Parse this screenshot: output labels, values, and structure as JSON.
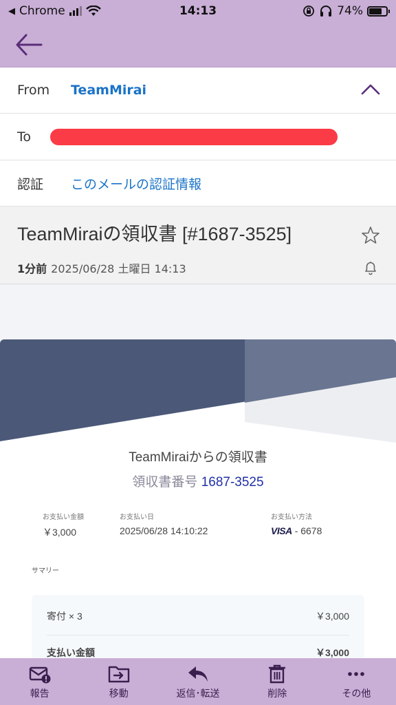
{
  "status": {
    "back_app": "Chrome",
    "time": "14:13",
    "battery": "74%",
    "battery_level": 0.74
  },
  "email": {
    "from_label": "From",
    "from_value": "TeamMirai",
    "to_label": "To",
    "auth_label": "認証",
    "auth_link": "このメールの認証情報",
    "subject": "TeamMiraiの領収書 [#1687-3525]",
    "relative_time": "1分前",
    "date": "2025/06/28 土曜日 14:13"
  },
  "receipt": {
    "title": "TeamMiraiからの領収書",
    "number_label": "領収書番号",
    "number": "1687-3525",
    "amount_label": "お支払い金額",
    "amount": "￥3,000",
    "date_label": "お支払い日",
    "date": "2025/06/28 14:10:22",
    "method_label": "お支払い方法",
    "card_brand": "VISA",
    "card_last4": "- 6678",
    "summary_label": "サマリー",
    "line_item": "寄付 × 3",
    "line_amount": "￥3,000",
    "total_label": "支払い金額",
    "total_amount": "￥3,000"
  },
  "toolbar": {
    "report": "報告",
    "move": "移動",
    "reply": "返信･転送",
    "delete": "削除",
    "more": "その他"
  },
  "colors": {
    "header_bg": "#c9aed6",
    "link": "#1a73c7",
    "redaction": "#fb3b45",
    "hero": "#4b5878"
  }
}
